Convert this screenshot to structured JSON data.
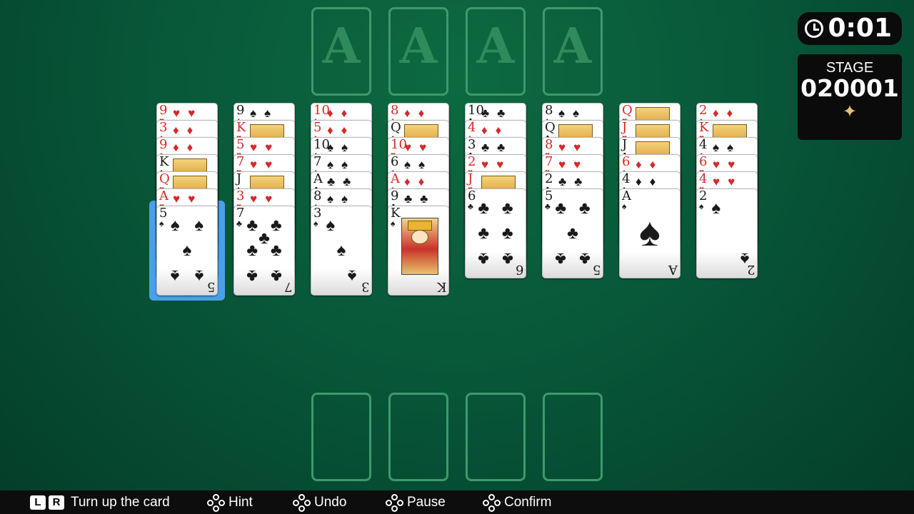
{
  "foundations": [
    {
      "label": "A"
    },
    {
      "label": "A"
    },
    {
      "label": "A"
    },
    {
      "label": "A"
    }
  ],
  "timer": {
    "time": "0:01",
    "icon": "clock-icon"
  },
  "stage": {
    "label": "STAGE",
    "number": "020001",
    "star": "✦"
  },
  "tableau": [
    {
      "covered": [
        {
          "rank": "9",
          "suit": "♥",
          "color": "red"
        },
        {
          "rank": "3",
          "suit": "♦",
          "color": "red"
        },
        {
          "rank": "9",
          "suit": "♦",
          "color": "red"
        },
        {
          "rank": "K",
          "suit": "♦",
          "color": "black"
        },
        {
          "rank": "Q",
          "suit": "♥",
          "color": "red"
        },
        {
          "rank": "A",
          "suit": "♥",
          "color": "red"
        }
      ],
      "top": {
        "rank": "5",
        "suit": "♠",
        "color": "black",
        "pips": 5
      }
    },
    {
      "covered": [
        {
          "rank": "9",
          "suit": "♠",
          "color": "black"
        },
        {
          "rank": "K",
          "suit": "♥",
          "color": "red"
        },
        {
          "rank": "5",
          "suit": "♥",
          "color": "red"
        },
        {
          "rank": "7",
          "suit": "♥",
          "color": "red"
        },
        {
          "rank": "J",
          "suit": "♦",
          "color": "black"
        },
        {
          "rank": "3",
          "suit": "♥",
          "color": "red"
        }
      ],
      "top": {
        "rank": "7",
        "suit": "♣",
        "color": "black",
        "pips": 7
      }
    },
    {
      "covered": [
        {
          "rank": "10",
          "suit": "♦",
          "color": "red"
        },
        {
          "rank": "5",
          "suit": "♦",
          "color": "red"
        },
        {
          "rank": "10",
          "suit": "♠",
          "color": "black"
        },
        {
          "rank": "7",
          "suit": "♠",
          "color": "black"
        },
        {
          "rank": "A",
          "suit": "♣",
          "color": "black"
        },
        {
          "rank": "8",
          "suit": "♠",
          "color": "black"
        }
      ],
      "top": {
        "rank": "3",
        "suit": "♠",
        "color": "black",
        "pips": 3
      }
    },
    {
      "covered": [
        {
          "rank": "8",
          "suit": "♦",
          "color": "red"
        },
        {
          "rank": "Q",
          "suit": "♠",
          "color": "black"
        },
        {
          "rank": "10",
          "suit": "♥",
          "color": "red"
        },
        {
          "rank": "6",
          "suit": "♠",
          "color": "black"
        },
        {
          "rank": "A",
          "suit": "♦",
          "color": "red"
        },
        {
          "rank": "9",
          "suit": "♣",
          "color": "black"
        }
      ],
      "top": {
        "rank": "K",
        "suit": "♠",
        "color": "black",
        "pips": 0
      }
    },
    {
      "covered": [
        {
          "rank": "10",
          "suit": "♣",
          "color": "black"
        },
        {
          "rank": "4",
          "suit": "♦",
          "color": "red"
        },
        {
          "rank": "3",
          "suit": "♣",
          "color": "black"
        },
        {
          "rank": "2",
          "suit": "♥",
          "color": "red"
        },
        {
          "rank": "J",
          "suit": "♥",
          "color": "red"
        }
      ],
      "top": {
        "rank": "6",
        "suit": "♣",
        "color": "black",
        "pips": 6
      }
    },
    {
      "covered": [
        {
          "rank": "8",
          "suit": "♠",
          "color": "black"
        },
        {
          "rank": "Q",
          "suit": "♣",
          "color": "black"
        },
        {
          "rank": "8",
          "suit": "♥",
          "color": "red"
        },
        {
          "rank": "7",
          "suit": "♥",
          "color": "red"
        },
        {
          "rank": "2",
          "suit": "♣",
          "color": "black"
        }
      ],
      "top": {
        "rank": "5",
        "suit": "♣",
        "color": "black",
        "pips": 5
      }
    },
    {
      "covered": [
        {
          "rank": "Q",
          "suit": "♥",
          "color": "red"
        },
        {
          "rank": "J",
          "suit": "♥",
          "color": "red"
        },
        {
          "rank": "J",
          "suit": "♣",
          "color": "black"
        },
        {
          "rank": "6",
          "suit": "♦",
          "color": "red"
        },
        {
          "rank": "4",
          "suit": "♦",
          "color": "black"
        }
      ],
      "top": {
        "rank": "A",
        "suit": "♠",
        "color": "black",
        "pips": 1
      }
    },
    {
      "covered": [
        {
          "rank": "2",
          "suit": "♦",
          "color": "red"
        },
        {
          "rank": "K",
          "suit": "♥",
          "color": "red"
        },
        {
          "rank": "4",
          "suit": "♠",
          "color": "black"
        },
        {
          "rank": "6",
          "suit": "♥",
          "color": "red"
        },
        {
          "rank": "4",
          "suit": "♥",
          "color": "red"
        }
      ],
      "top": {
        "rank": "2",
        "suit": "♠",
        "color": "black",
        "pips": 2
      }
    }
  ],
  "freecells": [
    {},
    {},
    {},
    {}
  ],
  "bottom_bar": {
    "lr_keys": [
      "L",
      "R"
    ],
    "turn_up": "Turn up the card",
    "hint": "Hint",
    "undo": "Undo",
    "pause": "Pause",
    "confirm": "Confirm"
  }
}
